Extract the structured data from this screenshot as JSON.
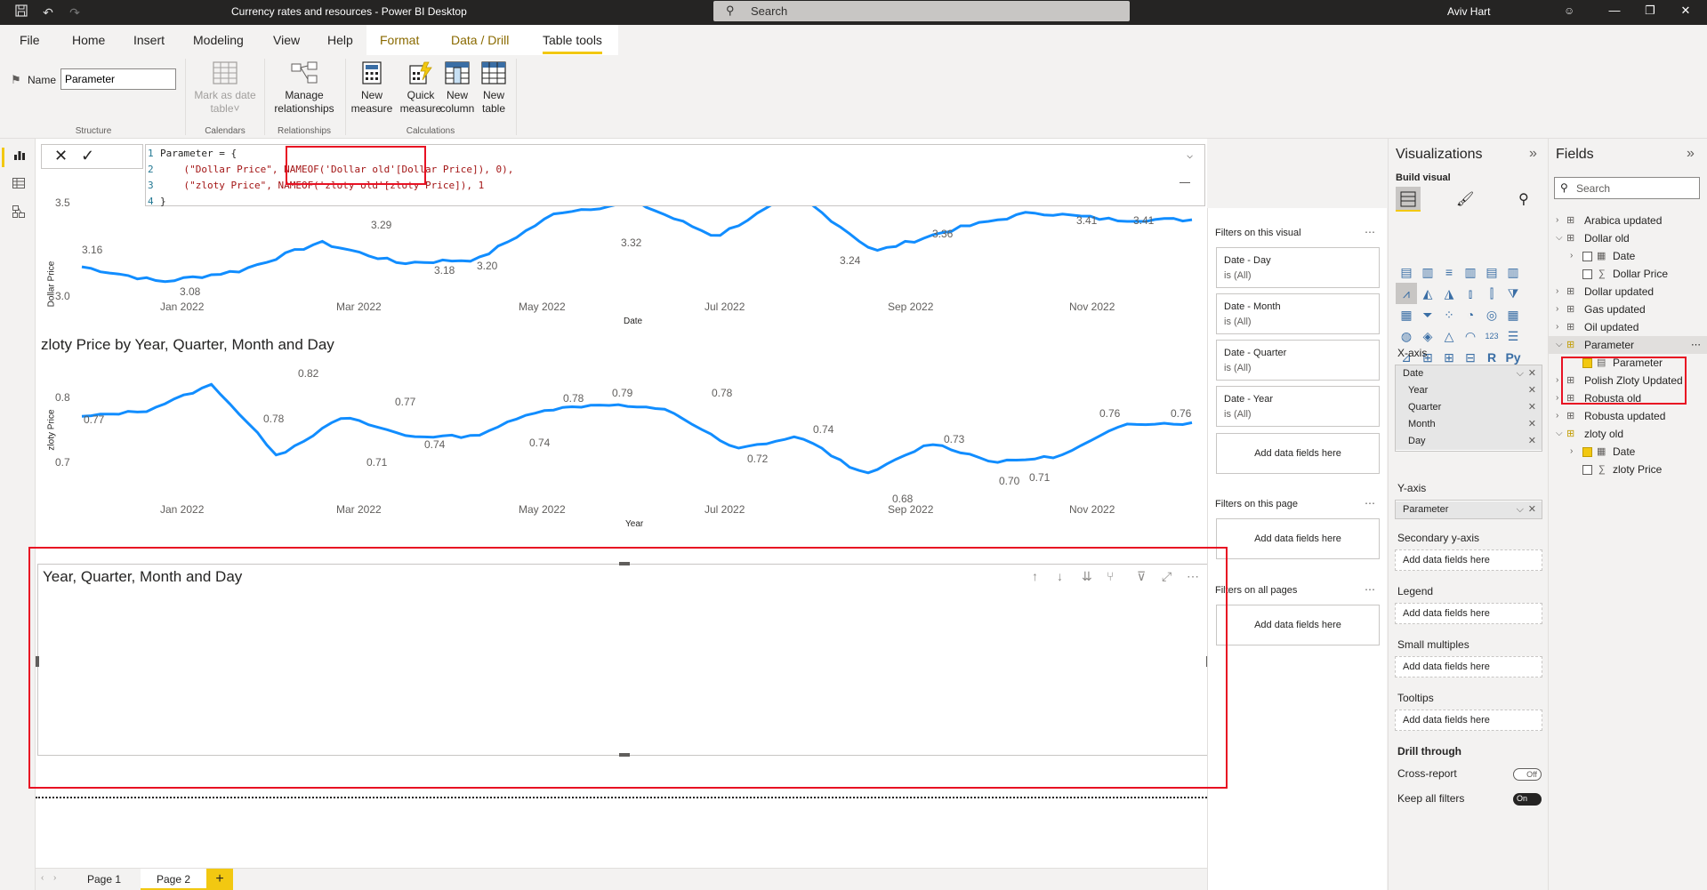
{
  "titlebar": {
    "title": "Currency rates and resources - Power BI Desktop",
    "search_placeholder": "Search",
    "user": "Aviv Hart"
  },
  "menu": {
    "items": [
      "File",
      "Home",
      "Insert",
      "Modeling",
      "View",
      "Help",
      "Format",
      "Data / Drill",
      "Table tools"
    ],
    "active": "Table tools"
  },
  "ribbon": {
    "name_label": "Name",
    "name_value": "Parameter",
    "structure_label": "Structure",
    "mark_as_date": [
      "Mark as date",
      "table"
    ],
    "calendars_label": "Calendars",
    "manage_rel": [
      "Manage",
      "relationships"
    ],
    "relationships_label": "Relationships",
    "new_measure": [
      "New",
      "measure"
    ],
    "quick_measure": [
      "Quick",
      "measure"
    ],
    "new_column": [
      "New",
      "column"
    ],
    "new_table": [
      "New",
      "table"
    ],
    "calculations_label": "Calculations"
  },
  "formula": {
    "lines": [
      {
        "n": "1",
        "text": "Parameter = {"
      },
      {
        "n": "2",
        "text": "    (\"Dollar Price\", NAMEOF('Dollar old'[Dollar Price]), 0),"
      },
      {
        "n": "3",
        "text": "    (\"zloty Price\", NAMEOF('zloty old'[zloty Price]), 1"
      },
      {
        "n": "4",
        "text": "}"
      }
    ]
  },
  "charts": {
    "chart1": {
      "ylabel": "Dollar Price",
      "xlabel": "Date",
      "yticks": [
        "3.5",
        "3.0"
      ],
      "xticks": [
        "Jan 2022",
        "Mar 2022",
        "May 2022",
        "Jul 2022",
        "Sep 2022",
        "Nov 2022"
      ],
      "labels": [
        "3.16",
        "3.08",
        "3.29",
        "3.18",
        "3.20",
        "3.32",
        "3.24",
        "3.36",
        "3.41",
        "3.41"
      ]
    },
    "chart2": {
      "title": "zloty Price by Year, Quarter, Month and Day",
      "ylabel": "zloty Price",
      "xlabel": "Year",
      "yticks": [
        "0.8",
        "0.7"
      ],
      "xticks": [
        "Jan 2022",
        "Mar 2022",
        "May 2022",
        "Jul 2022",
        "Sep 2022",
        "Nov 2022"
      ],
      "labels": [
        "0.77",
        "0.78",
        "0.82",
        "0.71",
        "0.77",
        "0.74",
        "0.74",
        "0.78",
        "0.79",
        "0.78",
        "0.72",
        "0.74",
        "0.68",
        "0.73",
        "0.70",
        "0.71",
        "0.76",
        "0.76"
      ]
    },
    "chart3": {
      "title": "Year, Quarter, Month and Day"
    }
  },
  "chart_data": [
    {
      "type": "line",
      "xlabel": "Date",
      "ylabel": "Dollar Price",
      "x": [
        "Jan 2022",
        "Mar 2022",
        "May 2022",
        "Jul 2022",
        "Sep 2022",
        "Nov 2022"
      ],
      "ylim": [
        3.0,
        3.5
      ],
      "data_labels": [
        3.16,
        3.08,
        3.29,
        3.18,
        3.2,
        3.32,
        3.24,
        3.36,
        3.41,
        3.41
      ],
      "series": [
        {
          "values": [
            3.16,
            3.08,
            3.14,
            3.29,
            3.18,
            3.2,
            3.45,
            3.5,
            3.32,
            3.55,
            3.24,
            3.36,
            3.45,
            3.41,
            3.41
          ]
        }
      ]
    },
    {
      "type": "line",
      "title": "zloty Price by Year, Quarter, Month and Day",
      "xlabel": "Year",
      "ylabel": "zloty Price",
      "x": [
        "Jan 2022",
        "Mar 2022",
        "May 2022",
        "Jul 2022",
        "Sep 2022",
        "Nov 2022"
      ],
      "ylim": [
        0.65,
        0.85
      ],
      "series": [
        {
          "values": [
            0.77,
            0.78,
            0.82,
            0.71,
            0.77,
            0.74,
            0.74,
            0.78,
            0.79,
            0.78,
            0.72,
            0.74,
            0.68,
            0.73,
            0.7,
            0.71,
            0.76,
            0.76
          ]
        }
      ]
    }
  ],
  "filters": {
    "on_visual": "Filters on this visual",
    "cards": [
      {
        "name": "Date - Day",
        "value": "is (All)"
      },
      {
        "name": "Date - Month",
        "value": "is (All)"
      },
      {
        "name": "Date - Quarter",
        "value": "is (All)"
      },
      {
        "name": "Date - Year",
        "value": "is (All)"
      }
    ],
    "add_fields": "Add data fields here",
    "on_page": "Filters on this page",
    "on_all": "Filters on all pages"
  },
  "viz": {
    "title": "Visualizations",
    "build": "Build visual",
    "xaxis": "X-axis",
    "xaxis_fields": [
      "Date",
      "Year",
      "Quarter",
      "Month",
      "Day"
    ],
    "yaxis": "Y-axis",
    "yaxis_field": "Parameter",
    "secondary": "Secondary y-axis",
    "legend": "Legend",
    "small_multiples": "Small multiples",
    "tooltips": "Tooltips",
    "drill_through": "Drill through",
    "cross_report": "Cross-report",
    "cross_report_state": "Off",
    "keep_filters": "Keep all filters",
    "keep_filters_state": "On",
    "add_fields": "Add data fields here"
  },
  "fields": {
    "title": "Fields",
    "search_placeholder": "Search",
    "tables": [
      {
        "name": "Arabica updated"
      },
      {
        "name": "Dollar old"
      },
      {
        "name": "Date"
      },
      {
        "name": "Dollar Price"
      },
      {
        "name": "Dollar updated"
      },
      {
        "name": "Gas updated"
      },
      {
        "name": "Oil updated"
      },
      {
        "name": "Parameter"
      },
      {
        "name": "Parameter"
      },
      {
        "name": "Polish Zloty Updated"
      },
      {
        "name": "Robusta old"
      },
      {
        "name": "Robusta updated"
      },
      {
        "name": "zloty old"
      },
      {
        "name": "Date"
      },
      {
        "name": "zloty Price"
      }
    ]
  },
  "pages": {
    "tabs": [
      "Page 1",
      "Page 2"
    ],
    "active": "Page 2",
    "add": "+"
  }
}
